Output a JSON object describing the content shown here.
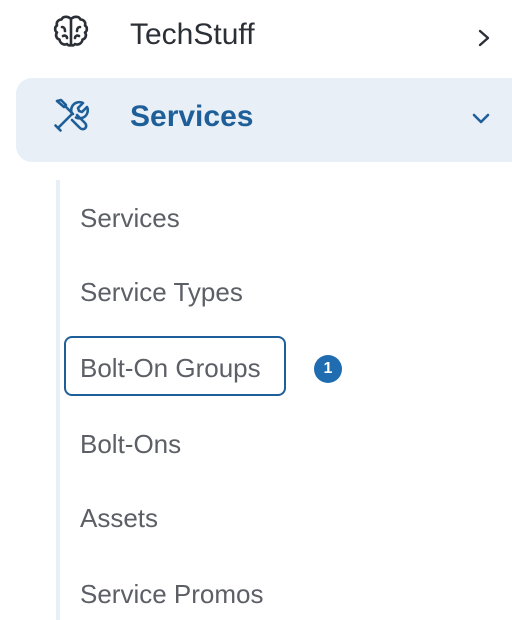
{
  "nav": {
    "techstuff": {
      "label": "TechStuff",
      "icon": "brain-icon",
      "chevron": "chevron-right-icon"
    },
    "services": {
      "label": "Services",
      "icon": "tools-icon",
      "chevron": "chevron-down-icon",
      "expanded": true
    },
    "sub_items": [
      {
        "label": "Services"
      },
      {
        "label": "Service Types"
      },
      {
        "label": "Bolt-On Groups",
        "focused": true,
        "badge": "1"
      },
      {
        "label": "Bolt-Ons"
      },
      {
        "label": "Assets"
      },
      {
        "label": "Service Promos"
      }
    ]
  },
  "colors": {
    "accent": "#1f5f99",
    "active_bg": "#e8eff7",
    "text_primary": "#2b2f36",
    "text_secondary": "#5c5f66",
    "badge_bg": "#1f6cb0"
  }
}
